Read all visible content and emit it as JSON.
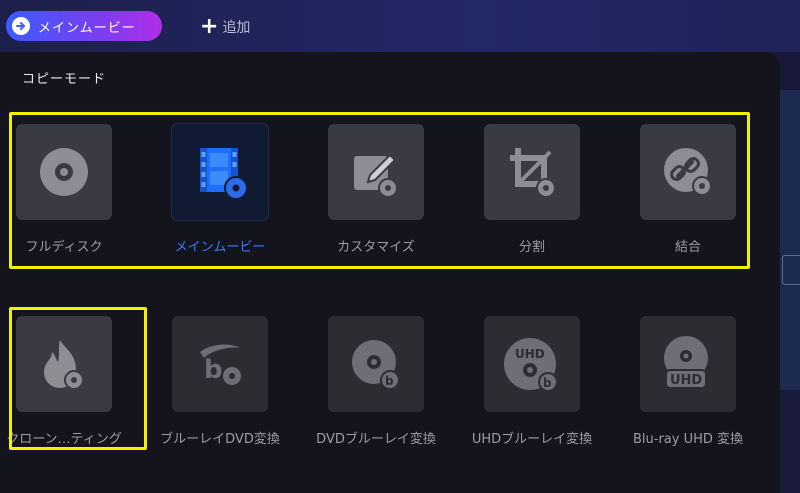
{
  "topbar": {
    "mode_label": "メインムービー",
    "add_label": "追加"
  },
  "panel": {
    "title": "コピーモード"
  },
  "modes_row1": [
    {
      "id": "full",
      "label": "フルディスク",
      "icon": "disc-icon"
    },
    {
      "id": "main",
      "label": "メインムービー",
      "icon": "film-disc-icon",
      "active": true
    },
    {
      "id": "custom",
      "label": "カスタマイズ",
      "icon": "edit-disc-icon"
    },
    {
      "id": "split",
      "label": "分割",
      "icon": "crop-disc-icon"
    },
    {
      "id": "merge",
      "label": "結合",
      "icon": "link-disc-icon"
    }
  ],
  "modes_row2": [
    {
      "id": "burn",
      "label": "クローン…ティング",
      "icon": "flame-disc-icon"
    },
    {
      "id": "bd2dvd",
      "label": "ブルーレイDVD変換",
      "icon": "bluray-disc-icon"
    },
    {
      "id": "dvd2bd",
      "label": "DVDブルーレイ変換",
      "icon": "dvd-bluray-icon"
    },
    {
      "id": "uhd2bd",
      "label": "UHDブルーレイ変換",
      "icon": "uhd-bluray-icon"
    },
    {
      "id": "bd2uhd",
      "label": "Blu-ray UHD 変換",
      "icon": "bluray-uhd-icon"
    }
  ],
  "colors": {
    "highlight": "#f4f100",
    "active_text": "#3a7bff",
    "accent_start": "#3b5cff",
    "accent_end": "#b02ee8"
  }
}
